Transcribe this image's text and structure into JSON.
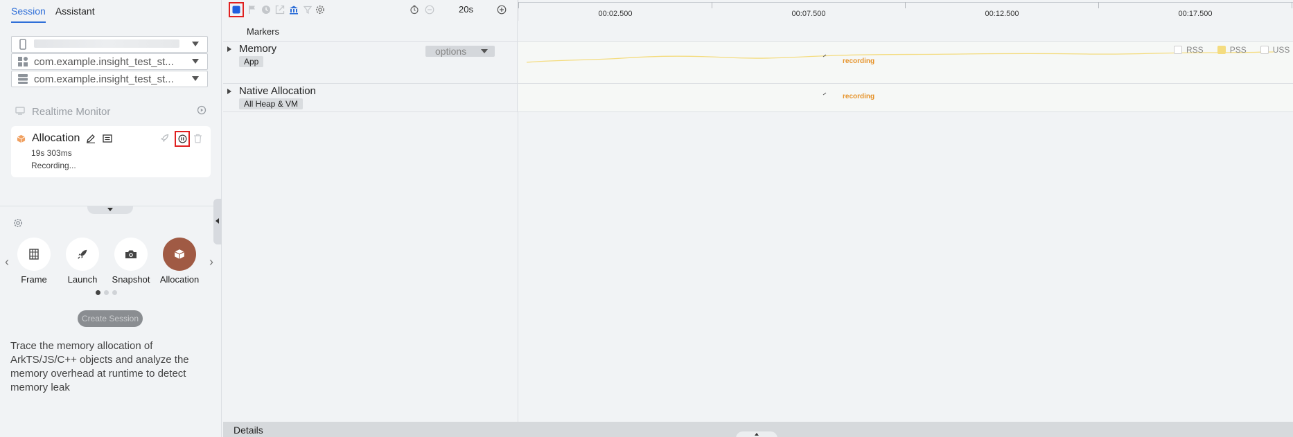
{
  "tabs": [
    {
      "label": "Session",
      "active": true
    },
    {
      "label": "Assistant",
      "active": false
    }
  ],
  "selectors": {
    "device": {
      "icon": "phone-icon",
      "value": ""
    },
    "app": {
      "icon": "apps-grid-icon",
      "value": "com.example.insight_test_st..."
    },
    "process": {
      "icon": "process-list-icon",
      "value": "com.example.insight_test_st..."
    }
  },
  "realtime": {
    "label": "Realtime Monitor"
  },
  "session_card": {
    "title": "Allocation",
    "duration": "19s 303ms",
    "status": "Recording..."
  },
  "carousel": {
    "items": [
      {
        "label": "Frame",
        "icon": "frame-icon",
        "active": false
      },
      {
        "label": "Launch",
        "icon": "rocket-icon",
        "active": false
      },
      {
        "label": "Snapshot",
        "icon": "camera-icon",
        "active": false
      },
      {
        "label": "Allocation",
        "icon": "cube-icon",
        "active": true
      }
    ],
    "page": 1,
    "pages": 3
  },
  "create_button": "Create Session",
  "description": "Trace the memory allocation of ArkTS/JS/C++ objects and analyze the memory overhead at runtime to detect memory leak",
  "toolbar": {
    "range": "20s"
  },
  "ruler": {
    "labels": [
      "00:02.500",
      "00:07.500",
      "00:12.500",
      "00:17.500"
    ]
  },
  "markers_label": "Markers",
  "tracks": {
    "memory": {
      "title": "Memory",
      "chip": "App",
      "options": "options",
      "recording": "recording",
      "legend": [
        {
          "label": "RSS",
          "checked": false
        },
        {
          "label": "PSS",
          "checked": true
        },
        {
          "label": "USS",
          "checked": false
        }
      ]
    },
    "native": {
      "title": "Native Allocation",
      "chip": "All Heap & VM",
      "recording": "recording"
    }
  },
  "details_label": "Details",
  "colors": {
    "accent": "#2f6fd8",
    "pss_line": "#f4dc7f",
    "recording": "#e6932a",
    "record_active": "#a05a44",
    "highlight": "#e02020"
  }
}
